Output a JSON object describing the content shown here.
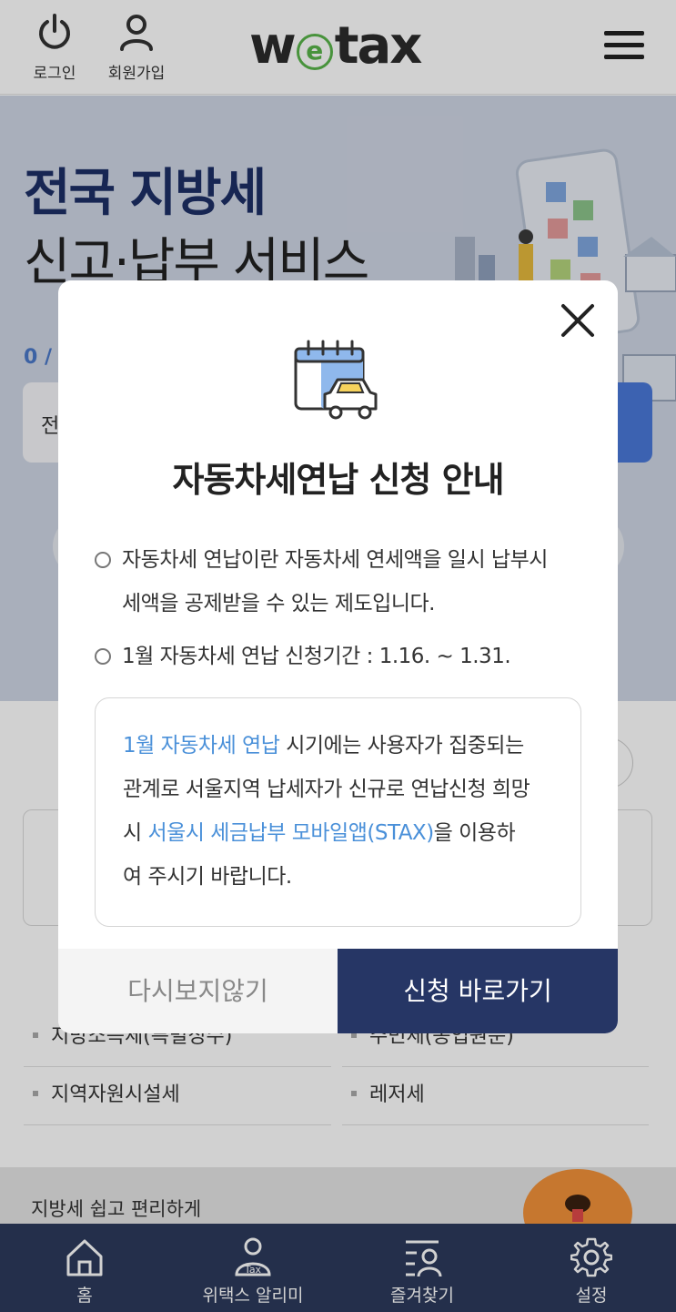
{
  "header": {
    "login_label": "로그인",
    "signup_label": "회원가입",
    "logo_prefix": "w",
    "logo_e": "e",
    "logo_suffix": "tax"
  },
  "hero": {
    "title_line1": "전국 지방세",
    "title_line2": "신고·납부 서비스",
    "count_text": "0 / 1",
    "search_text": "전"
  },
  "tax_list": [
    {
      "label": "지방소득세(특별징수)"
    },
    {
      "label": "주민세(종업원분)"
    },
    {
      "label": "지역자원시설세"
    },
    {
      "label": "레저세"
    }
  ],
  "banner": {
    "text": "지방세 쉽고 편리하게"
  },
  "bottom_nav": {
    "home": "홈",
    "alarm": "위택스 알리미",
    "favorites": "즐겨찾기",
    "settings": "설정"
  },
  "modal": {
    "title": "자동차세연납 신청 안내",
    "item1_line1": "자동차세 연납이란 자동차세 연세액을 일시 납부시",
    "item1_line2": "세액을 공제받을 수 있는 제도입니다.",
    "item2": "1월 자동차세 연납 신청기간 : 1.16. ~ 1.31.",
    "notice": {
      "hl1": "1월 자동차세 연납",
      "t1": " 시기에는 사용자가 집중되는",
      "t2": "관계로 서울지역 납세자가 신규로 연납신청 희망",
      "t3a": "시 ",
      "hl2": "서울시 세금납부 모바일앱(STAX)",
      "t3b": "을 이용하",
      "t4": "여 주시기 바랍니다."
    },
    "dismiss_label": "다시보지않기",
    "apply_label": "신청 바로가기"
  },
  "colors": {
    "brand_navy": "#263665",
    "highlight_blue": "#4a90d9",
    "logo_green": "#58b44a",
    "nav_bg": "#2c3a5c"
  }
}
